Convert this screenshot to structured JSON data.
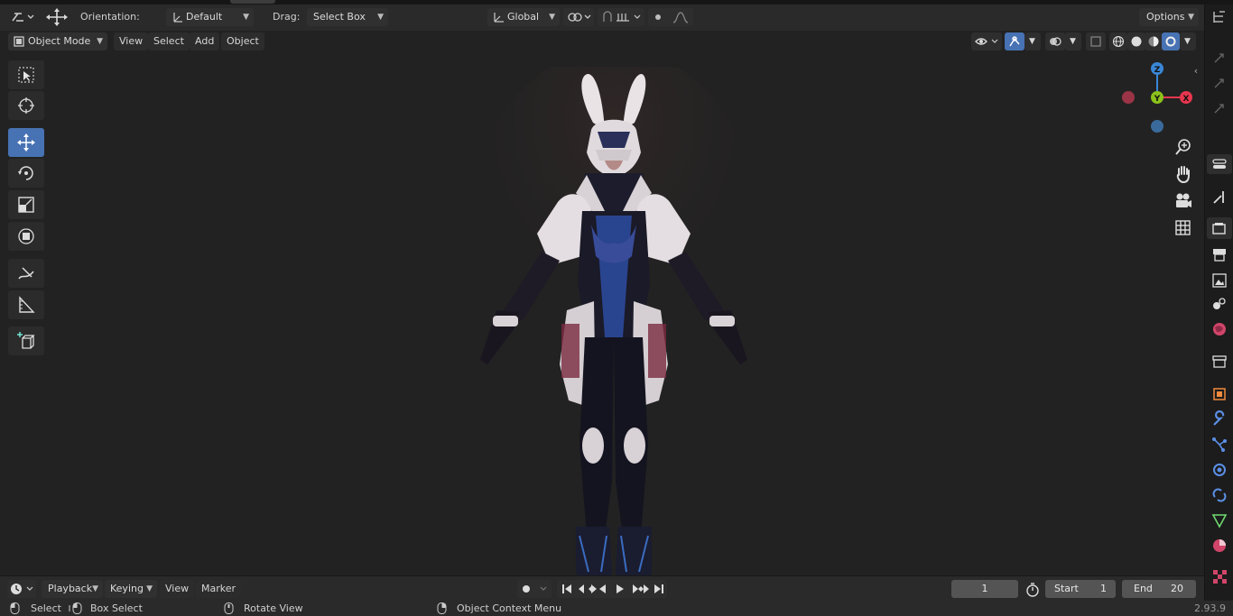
{
  "header": {
    "orientation_label": "Orientation:",
    "orientation_value": "Default",
    "drag_label": "Drag:",
    "drag_value": "Select Box",
    "transform_space": "Global",
    "options_label": "Options"
  },
  "viewport_header": {
    "mode": "Object Mode",
    "menus": [
      "View",
      "Select",
      "Add",
      "Object"
    ]
  },
  "gizmo": {
    "z": "Z",
    "y": "Y",
    "x": "X"
  },
  "timeline": {
    "menus": [
      "Playback",
      "Keying",
      "View",
      "Marker"
    ],
    "current_frame": "1",
    "start_label": "Start",
    "start_value": "1",
    "end_label": "End",
    "end_value": "20"
  },
  "status_bar": {
    "select": "Select",
    "box_select": "Box Select",
    "rotate_view": "Rotate View",
    "context_menu": "Object Context Menu",
    "version": "2.93.9"
  },
  "colors": {
    "accent": "#4772b3",
    "axis_x": "#e8364e",
    "axis_y": "#8bc21b",
    "axis_z": "#3a86d5",
    "background": "#222222"
  }
}
